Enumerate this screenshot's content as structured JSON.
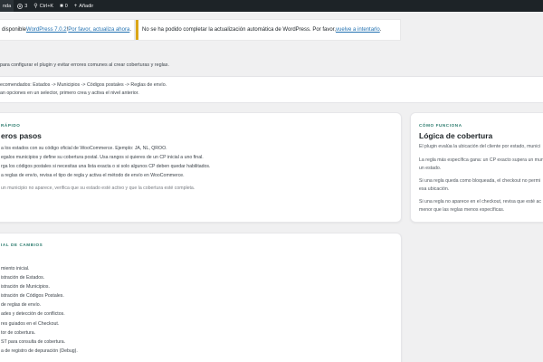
{
  "adminbar": {
    "site_label": "nda",
    "updates_count": "3",
    "shortcut": "Ctrl+K",
    "comments_count": "0",
    "add_new": "Añadir"
  },
  "notices": {
    "update_prefix": "disponible ",
    "update_link": "WordPress 7.0.2",
    "update_sep": "! ",
    "update_action": "Por favor, actualiza ahora",
    "update_suffix": ".",
    "autoupdate_text": "No se ha podido completar la actualización automática de WordPress. Por favor, ",
    "autoupdate_link": "vuelve a intentarlo",
    "autoupdate_suffix": "."
  },
  "intro": "para configurar el plugin y evitar errores comunes al crear coberturas y reglas.",
  "steps": [
    "ecomendados: Estados -> Municipios -> Códigos postales -> Reglas de envío.",
    "an opciones en un selector, primero crea y activa el nivel anterior."
  ],
  "quick": {
    "eyebrow": "RÁPIDO",
    "title": "eros pasos",
    "items": [
      "a los estados con su código oficial de WooCommerce. Ejemplo: JA, NL, QROO.",
      "egalos municipios y define su cobertura postal. Usa rangos si quieres de un CP inicial a uno final.",
      "rga los códigos postales si necesitas una lista exacta o si solo algunos CP deben quedar habilitados.",
      "a reglas de envío, revisa el tipo de regla y activa el método de envío en WooCommerce."
    ],
    "note": "un municipio no aparece, verifica que su estado esté activo y que la cobertura esté completa."
  },
  "how": {
    "eyebrow": "CÓMO FUNCIONA",
    "title": "Lógica de cobertura",
    "paragraphs": [
      [
        "El plugin evalúa la ubicación del cliente por estado, munici"
      ],
      [
        "La regla más específica gana: un CP exacto supera un mun",
        "un estado."
      ],
      [
        "Si una regla queda como bloqueada, el checkout no permi",
        "esa ubicación."
      ],
      [
        "Si una regla no aparece en el checkout, revisa que esté ac",
        "menor que las reglas menos específicas."
      ]
    ]
  },
  "changelog": {
    "eyebrow": "IAL DE CAMBIOS",
    "items": [
      "miento inicial.",
      "istración de Estados.",
      "istración de Municipios.",
      "istración de Códigos Postales.",
      "de reglas de envío.",
      "ades y detección de conflictos.",
      "res guiados en el Checkout.",
      "tor de cobertura.",
      "ST para consulta de cobertura.",
      "a de registro de depuración (Debug)."
    ]
  },
  "colors": {
    "adminbar_bg": "#1d2327",
    "notice_border": "#dba617",
    "link": "#2271b1",
    "eyebrow": "#2a7a6c"
  }
}
